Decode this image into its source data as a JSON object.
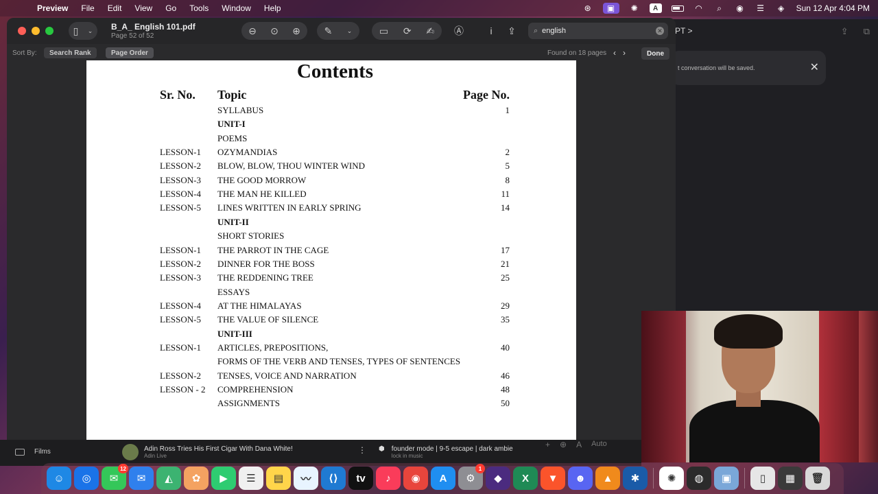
{
  "menubar": {
    "app_name": "Preview",
    "menus": [
      "File",
      "Edit",
      "View",
      "Go",
      "Tools",
      "Window",
      "Help"
    ],
    "clock": "Sun 12 Apr  4:04 PM",
    "keyboard_layout": "A"
  },
  "chat_window": {
    "title_fragment": "PT >",
    "toast_text": "t conversation will be saved."
  },
  "preview": {
    "doc_name": "B_A_ English 101.pdf",
    "doc_page_info": "Page 52 of 52",
    "search_value": "english",
    "sort_by_label": "Sort By:",
    "sort_options": [
      "Search Rank",
      "Page Order"
    ],
    "sort_selected": "Page Order",
    "found_text": "Found on 18 pages",
    "done_label": "Done"
  },
  "pdf": {
    "title": "Contents",
    "header": {
      "sr": "Sr. No.",
      "topic": "Topic",
      "page": "Page No."
    },
    "rows": [
      {
        "sr": "",
        "topic": "SYLLABUS",
        "page": "1",
        "bold": false
      },
      {
        "sr": "",
        "topic": "UNIT-I",
        "page": "",
        "bold": true
      },
      {
        "sr": "",
        "topic": "POEMS",
        "page": "",
        "bold": false
      },
      {
        "sr": "LESSON-1",
        "topic": "OZYMANDIAS",
        "page": "2",
        "bold": false
      },
      {
        "sr": "LESSON-2",
        "topic": "BLOW, BLOW, THOU WINTER WIND",
        "page": "5",
        "bold": false
      },
      {
        "sr": "LESSON-3",
        "topic": "THE GOOD MORROW",
        "page": "8",
        "bold": false
      },
      {
        "sr": "LESSON-4",
        "topic": "THE MAN HE KILLED",
        "page": "11",
        "bold": false
      },
      {
        "sr": "LESSON-5",
        "topic": "LINES WRITTEN IN EARLY SPRING",
        "page": "14",
        "bold": false
      },
      {
        "sr": "",
        "topic": "UNIT-II",
        "page": "",
        "bold": true
      },
      {
        "sr": "",
        "topic": "SHORT STORIES",
        "page": "",
        "bold": false
      },
      {
        "sr": "LESSON-1",
        "topic": "THE PARROT IN THE CAGE",
        "page": "17",
        "bold": false
      },
      {
        "sr": "LESSON-2",
        "topic": "DINNER FOR  THE BOSS",
        "page": "21",
        "bold": false
      },
      {
        "sr": "LESSON-3",
        "topic": "THE REDDENING TREE",
        "page": "25",
        "bold": false
      },
      {
        "sr": "",
        "topic": "ESSAYS",
        "page": "",
        "bold": false
      },
      {
        "sr": "LESSON-4",
        "topic": "AT THE HIMALAYAS",
        "page": "29",
        "bold": false
      },
      {
        "sr": "LESSON-5",
        "topic": "THE VALUE OF SILENCE",
        "page": "35",
        "bold": false
      },
      {
        "sr": "",
        "topic": "UNIT-III",
        "page": "",
        "bold": true
      },
      {
        "sr": "LESSON-1",
        "topic": "ARTICLES, PREPOSITIONS,",
        "page": "40",
        "bold": false
      },
      {
        "sr": "",
        "topic": "FORMS OF THE VERB AND TENSES, TYPES OF SENTENCES",
        "page": "",
        "bold": false
      },
      {
        "sr": "LESSON-2",
        "topic": "TENSES, VOICE AND NARRATION",
        "page": "46",
        "bold": false
      },
      {
        "sr": "LESSON - 2",
        "topic": "COMPREHENSION",
        "page": "48",
        "bold": false
      },
      {
        "sr": "",
        "topic": "ASSIGNMENTS",
        "page": "50",
        "bold": false
      }
    ]
  },
  "bottom": {
    "films_label": "Films",
    "video1_title": "Adin Ross Tries His First Cigar With Dana White!",
    "video1_sub": "Adin Live",
    "video2_title": "founder mode | 9-5 escape | dark ambie",
    "video2_sub": "lock in music",
    "auto_label": "Auto"
  },
  "dock": {
    "items": [
      {
        "name": "finder",
        "glyph": "☺",
        "color": "#1e88e5",
        "badge": ""
      },
      {
        "name": "safari",
        "glyph": "◎",
        "color": "#1a73e8",
        "badge": ""
      },
      {
        "name": "messages",
        "glyph": "✉",
        "color": "#34c759",
        "badge": "12"
      },
      {
        "name": "mail",
        "glyph": "✉",
        "color": "#2f80ed",
        "badge": ""
      },
      {
        "name": "maps",
        "glyph": "◭",
        "color": "#3cb371",
        "badge": ""
      },
      {
        "name": "photos",
        "glyph": "✿",
        "color": "#f4a261",
        "badge": ""
      },
      {
        "name": "facetime",
        "glyph": "▶",
        "color": "#2ecc71",
        "badge": ""
      },
      {
        "name": "reminders",
        "glyph": "☰",
        "color": "#f0f0f0",
        "badge": ""
      },
      {
        "name": "notes",
        "glyph": "▤",
        "color": "#ffd54a",
        "badge": ""
      },
      {
        "name": "freeform",
        "glyph": "〰",
        "color": "#e8f4ff",
        "badge": ""
      },
      {
        "name": "vscode",
        "glyph": "⟨⟩",
        "color": "#1f7ad2",
        "badge": ""
      },
      {
        "name": "appletv",
        "glyph": "tv",
        "color": "#111111",
        "badge": ""
      },
      {
        "name": "music",
        "glyph": "♪",
        "color": "#fa3c5a",
        "badge": ""
      },
      {
        "name": "chrome",
        "glyph": "◉",
        "color": "#e8453c",
        "badge": ""
      },
      {
        "name": "appstore",
        "glyph": "A",
        "color": "#1f8ef1",
        "badge": ""
      },
      {
        "name": "settings",
        "glyph": "⚙",
        "color": "#8e8e93",
        "badge": "1"
      },
      {
        "name": "obsidian",
        "glyph": "◆",
        "color": "#4b2b7f",
        "badge": ""
      },
      {
        "name": "excel",
        "glyph": "X",
        "color": "#1f8a55",
        "badge": ""
      },
      {
        "name": "brave",
        "glyph": "▼",
        "color": "#fb542b",
        "badge": ""
      },
      {
        "name": "discord",
        "glyph": "☻",
        "color": "#5865f2",
        "badge": ""
      },
      {
        "name": "vlc",
        "glyph": "▲",
        "color": "#f08a1c",
        "badge": ""
      },
      {
        "name": "perplexity",
        "glyph": "✱",
        "color": "#1a5ba8",
        "badge": ""
      },
      {
        "name": "chatgpt",
        "glyph": "✺",
        "color": "#ffffff",
        "badge": ""
      },
      {
        "name": "obs",
        "glyph": "◍",
        "color": "#2b2b2b",
        "badge": ""
      },
      {
        "name": "preview",
        "glyph": "▣",
        "color": "#7aa7d8",
        "badge": ""
      },
      {
        "name": "document",
        "glyph": "▯",
        "color": "#e6e6e6",
        "badge": ""
      },
      {
        "name": "screenshot",
        "glyph": "▦",
        "color": "#3a3a3a",
        "badge": ""
      },
      {
        "name": "trash",
        "glyph": "🗑",
        "color": "#d8d8d8",
        "badge": ""
      }
    ]
  }
}
